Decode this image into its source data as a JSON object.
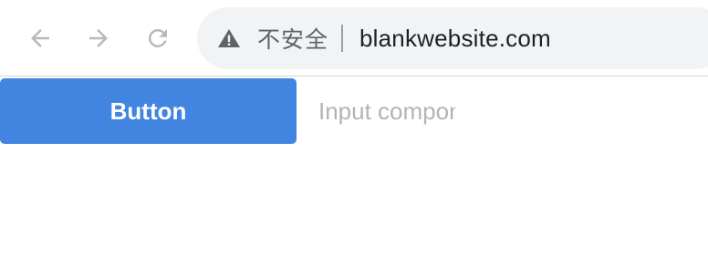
{
  "browser": {
    "nav": {
      "back_icon": "arrow-left-icon",
      "forward_icon": "arrow-right-icon",
      "reload_icon": "reload-icon"
    },
    "omnibox": {
      "security_icon": "warning-triangle-icon",
      "security_label": "不安全",
      "url": "blankwebsite.com"
    }
  },
  "page": {
    "button_label": "Button",
    "input": {
      "placeholder": "Input component",
      "value": ""
    }
  },
  "colors": {
    "button_bg": "#4285e0",
    "omnibox_bg": "#f1f3f4",
    "icon_gray": "#9aa0a6",
    "placeholder": "#b0b4b9"
  }
}
